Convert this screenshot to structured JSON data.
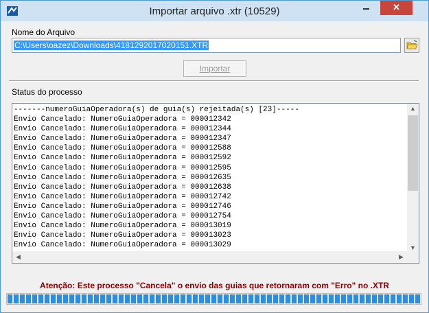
{
  "window": {
    "title": "Importar arquivo .xtr (10529)",
    "close_symbol": "✕",
    "icons": {
      "app": "app-logo-icon",
      "minimize": "minimize-icon",
      "close": "close-icon",
      "folder": "open-folder-icon"
    }
  },
  "file": {
    "label": "Nome do Arquivo",
    "value": "C:\\Users\\oazez\\Downloads\\4181292017020151.XTR"
  },
  "import_button": {
    "label": "Importar"
  },
  "status": {
    "label": "Status do processo",
    "log_lines": [
      "-------numeroGuiaOperadora(s) de guia(s) rejeitada(s) [23]-----",
      "Envio Cancelado: NumeroGuiaOperadora = 000012342",
      "Envio Cancelado: NumeroGuiaOperadora = 000012344",
      "Envio Cancelado: NumeroGuiaOperadora = 000012347",
      "Envio Cancelado: NumeroGuiaOperadora = 000012588",
      "Envio Cancelado: NumeroGuiaOperadora = 000012592",
      "Envio Cancelado: NumeroGuiaOperadora = 000012595",
      "Envio Cancelado: NumeroGuiaOperadora = 000012635",
      "Envio Cancelado: NumeroGuiaOperadora = 000012638",
      "Envio Cancelado: NumeroGuiaOperadora = 000012742",
      "Envio Cancelado: NumeroGuiaOperadora = 000012746",
      "Envio Cancelado: NumeroGuiaOperadora = 000012754",
      "Envio Cancelado: NumeroGuiaOperadora = 000013019",
      "Envio Cancelado: NumeroGuiaOperadora = 000013023",
      "Envio Cancelado: NumeroGuiaOperadora = 000013029"
    ]
  },
  "warning": "Atenção: Este processo \"Cancela\" o envio das guias que retornaram com \"Erro\" no .XTR",
  "progress": {
    "fraction": 1.0,
    "color": "#2a8fdf"
  },
  "colors": {
    "title_bar": "#cfe2f3",
    "close_button": "#c7453b",
    "warning_text": "#8b0000",
    "selection": "#3399ff"
  }
}
